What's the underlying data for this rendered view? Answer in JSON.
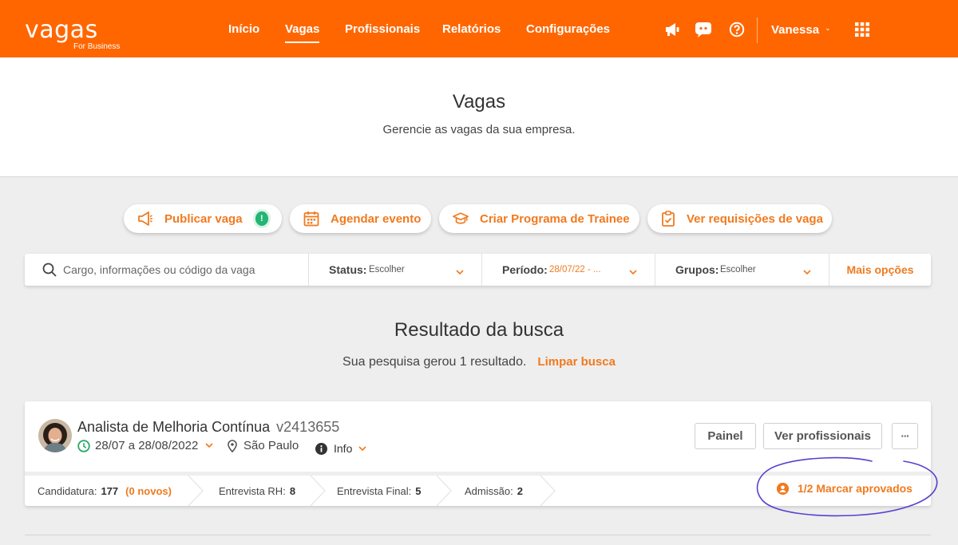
{
  "header": {
    "logo_text": "vagas",
    "logo_sub": "For Business",
    "nav": [
      {
        "label": "Início",
        "active": false
      },
      {
        "label": "Vagas",
        "active": true
      },
      {
        "label": "Profissionais",
        "active": false
      },
      {
        "label": "Relatórios",
        "active": false
      },
      {
        "label": "Configurações",
        "active": false
      }
    ],
    "icons": [
      "megaphone-icon",
      "chat-icon",
      "help-icon",
      "apps-grid-icon"
    ],
    "user": "Vanessa",
    "brand_color": "#ff6600"
  },
  "page": {
    "title": "Vagas",
    "subtitle": "Gerencie as vagas da sua empresa."
  },
  "actions": {
    "publish": "Publicar vaga",
    "publish_badge": "!",
    "schedule": "Agendar evento",
    "trainee": "Criar Programa de Trainee",
    "requisitions": "Ver requisições de vaga"
  },
  "search": {
    "placeholder": "Cargo, informações ou código da vaga",
    "status_label": "Status:",
    "status_value": "Escolher",
    "period_label": "Período:",
    "period_value": "28/07/22 - ...",
    "groups_label": "Grupos:",
    "groups_value": "Escolher",
    "more_options": "Mais opções"
  },
  "results": {
    "title": "Resultado da busca",
    "summary": "Sua pesquisa gerou 1 resultado.",
    "clear": "Limpar busca"
  },
  "job": {
    "title": "Analista de Melhoria Contínua",
    "code": "v2413655",
    "dates": "28/07 a 28/08/2022",
    "location": "São Paulo",
    "info": "Info",
    "panel_button": "Painel",
    "professionals_button": "Ver profissionais",
    "more_button": "···",
    "stages": {
      "candidatura_label": "Candidatura:",
      "candidatura_count": "177",
      "novos": "(0 novos)",
      "rh_label": "Entrevista RH:",
      "rh_count": "8",
      "final_label": "Entrevista Final:",
      "final_count": "5",
      "admissao_label": "Admissão:",
      "admissao_count": "2"
    },
    "approve_label": "1/2 Marcar aprovados"
  }
}
